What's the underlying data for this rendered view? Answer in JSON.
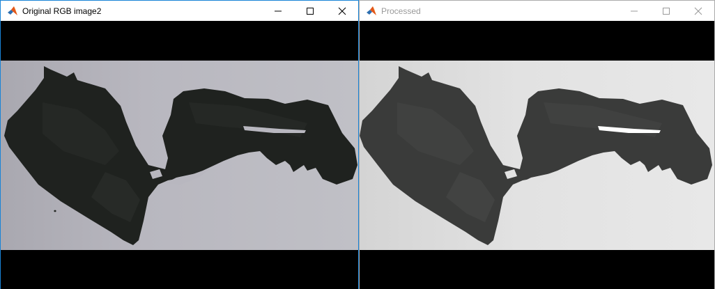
{
  "windows": [
    {
      "title": "Original RGB image2"
    },
    {
      "title": "Processed"
    }
  ],
  "icons": {
    "app": "matlab-logo-icon",
    "minimize": "minimize-icon",
    "maximize": "maximize-icon",
    "close": "close-icon"
  },
  "colors": {
    "active_border": "#1883d7",
    "original_background": "#b8b7bf",
    "original_object": "#1f221f",
    "processed_background": "#e2e2e2",
    "processed_object": "#3a3b3a"
  }
}
